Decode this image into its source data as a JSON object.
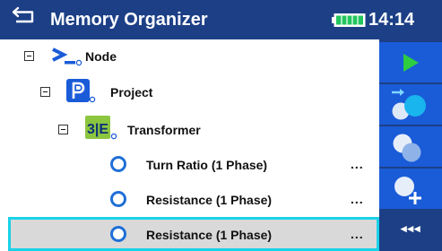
{
  "header": {
    "title": "Memory Organizer",
    "time": "14:14",
    "back_icon": "back-arrow-icon",
    "battery_icon": "battery-full-icon",
    "battery_level": 1.0
  },
  "tree": {
    "items": [
      {
        "label": "Node",
        "icon": "node-prompt-icon",
        "level": 0,
        "expanded": true
      },
      {
        "label": "Project",
        "icon": "project-icon",
        "level": 1,
        "expanded": true
      },
      {
        "label": "Transformer",
        "icon": "transformer-icon",
        "level": 2,
        "expanded": true
      },
      {
        "label": "Turn Ratio (1 Phase)",
        "icon": "measurement-circle-icon",
        "level": 3,
        "more": "..."
      },
      {
        "label": "Resistance (1 Phase)",
        "icon": "measurement-circle-icon",
        "level": 3,
        "more": "..."
      },
      {
        "label": "Resistance (1 Phase)",
        "icon": "measurement-circle-icon",
        "level": 3,
        "more": "...",
        "selected": true
      }
    ]
  },
  "sidebar": {
    "buttons": [
      {
        "icon": "play-icon"
      },
      {
        "icon": "copy-to-icon"
      },
      {
        "icon": "clone-icon"
      },
      {
        "icon": "add-new-icon"
      },
      {
        "icon": "more-options-icon",
        "label": "◂◂◂"
      }
    ]
  },
  "colors": {
    "header_bg": "#1c3f86",
    "sidebar_button_bg": "#1a5bd8",
    "selection_outline": "#19d2e8",
    "selection_bg": "#d9d9d9",
    "play_green": "#2ecc40",
    "battery_green": "#22c55e"
  }
}
